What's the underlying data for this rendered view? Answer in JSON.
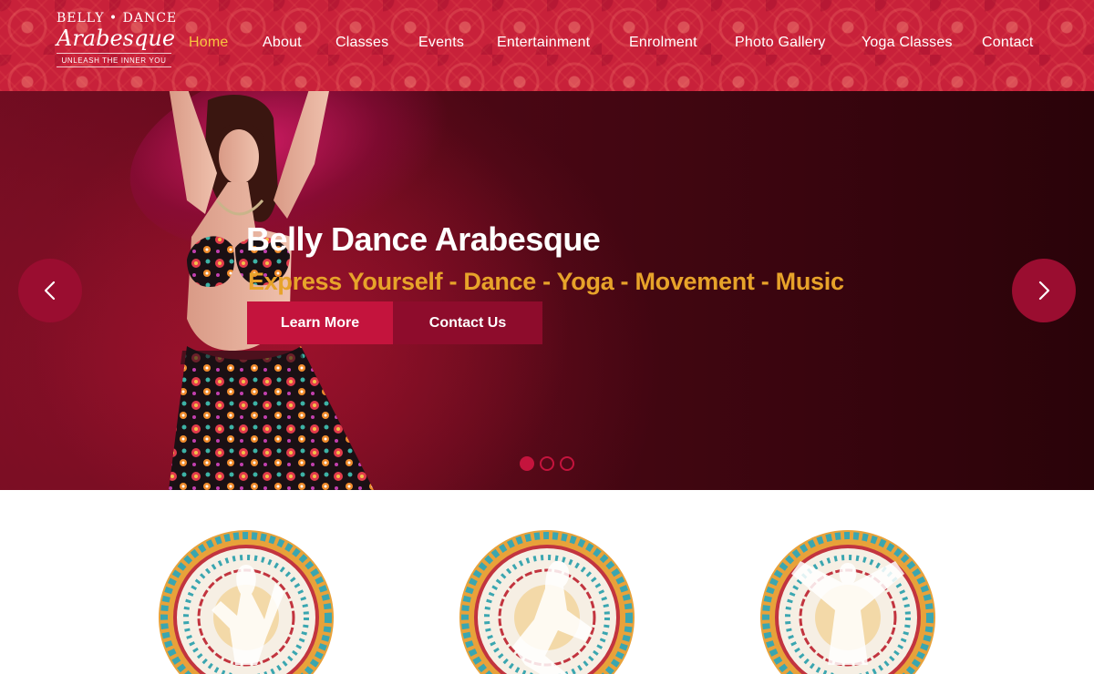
{
  "logo": {
    "top": "BELLY • DANCE",
    "main": "Arabesque",
    "tagline": "UNLEASH THE INNER YOU"
  },
  "nav": {
    "items": [
      {
        "label": "Home",
        "active": true
      },
      {
        "label": "About"
      },
      {
        "label": "Classes"
      },
      {
        "label": "Events"
      },
      {
        "label": "Entertainment"
      },
      {
        "label": "Enrolment"
      },
      {
        "label": "Photo Gallery"
      },
      {
        "label": "Yoga Classes"
      },
      {
        "label": "Contact"
      }
    ]
  },
  "hero": {
    "title": "Belly Dance Arabesque",
    "subtitle": "Express Yourself - Dance - Yoga - Movement - Music",
    "learn_more": "Learn More",
    "contact_us": "Contact Us",
    "slides_total": 3,
    "active_slide": 1
  },
  "icons": {
    "prev": "chevron-left-icon",
    "next": "chevron-right-icon"
  },
  "colors": {
    "header_red": "#c8213a",
    "nav_active": "#f7c540",
    "subtitle_gold": "#e7a32a",
    "button_primary": "#c4143d",
    "button_secondary": "#8e0c2c",
    "arrow_bg": "#9a0d30"
  }
}
